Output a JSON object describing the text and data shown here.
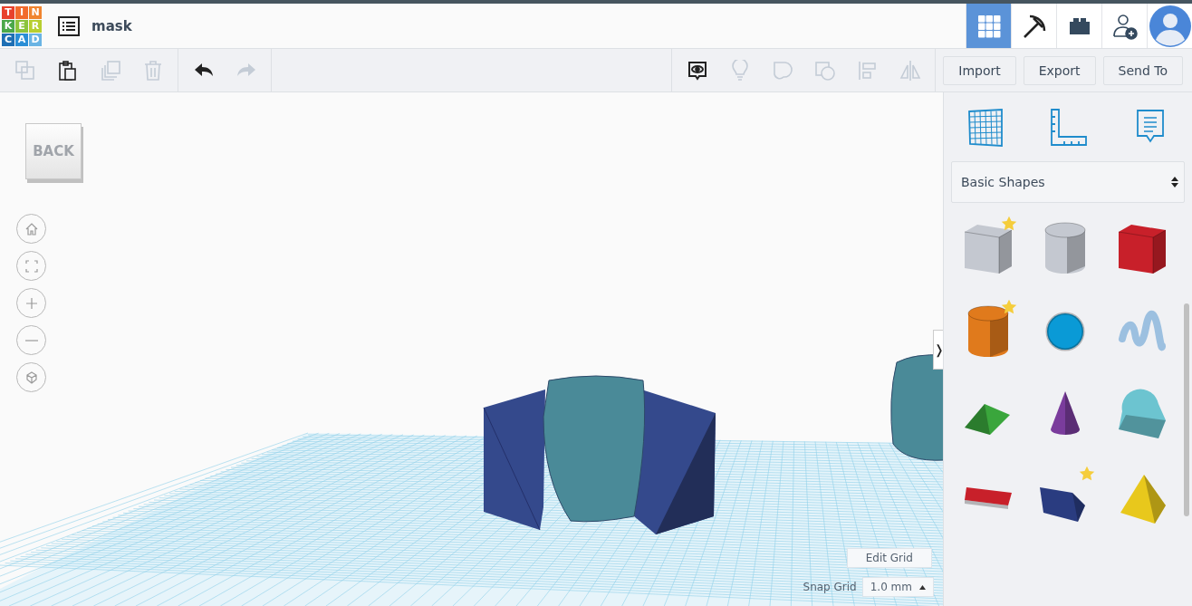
{
  "logo": {
    "letters": [
      "T",
      "I",
      "N",
      "K",
      "E",
      "R",
      "C",
      "A",
      "D"
    ]
  },
  "title": "mask",
  "nav": [
    {
      "kind": "grid",
      "selected": true
    },
    {
      "kind": "pickaxe",
      "selected": false
    },
    {
      "kind": "brick",
      "selected": false
    },
    {
      "kind": "invite",
      "selected": false
    },
    {
      "kind": "avatar",
      "selected": false
    }
  ],
  "edit_tools": [
    {
      "kind": "copy",
      "disabled": true
    },
    {
      "kind": "paste",
      "disabled": false
    },
    {
      "kind": "duplicate",
      "disabled": true
    },
    {
      "kind": "delete",
      "disabled": true
    }
  ],
  "history_tools": [
    {
      "kind": "undo",
      "disabled": false
    },
    {
      "kind": "redo",
      "disabled": true
    }
  ],
  "view_tools": [
    {
      "kind": "notes",
      "disabled": false
    },
    {
      "kind": "bulb",
      "disabled": true
    },
    {
      "kind": "group",
      "disabled": true
    },
    {
      "kind": "ungroup",
      "disabled": true
    },
    {
      "kind": "align",
      "disabled": true
    },
    {
      "kind": "mirror",
      "disabled": true
    }
  ],
  "actions": [
    "Import",
    "Export",
    "Send To"
  ],
  "view_cube": "BACK",
  "view_controls": [
    {
      "kind": "home"
    },
    {
      "kind": "fit"
    },
    {
      "kind": "zoom-in"
    },
    {
      "kind": "zoom-out"
    },
    {
      "kind": "perspective"
    }
  ],
  "edit_grid": "Edit Grid",
  "snap_grid": {
    "label": "Snap Grid",
    "value": "1.0 mm"
  },
  "panel_toggle": "❭",
  "panel_tools": [
    {
      "kind": "workplane"
    },
    {
      "kind": "ruler"
    },
    {
      "kind": "note"
    }
  ],
  "shape_library": "Basic Shapes",
  "shapes": [
    {
      "kind": "box",
      "color": "#c4c8d0",
      "favorite": true
    },
    {
      "kind": "cylinder",
      "color": "#c4c8d0",
      "favorite": false
    },
    {
      "kind": "box",
      "color": "#c8202a",
      "favorite": false
    },
    {
      "kind": "cylinder",
      "color": "#e07a1c",
      "favorite": true
    },
    {
      "kind": "sphere",
      "color": "#0a9ad6",
      "favorite": false
    },
    {
      "kind": "scribble",
      "color": "#9cc0e0",
      "favorite": false
    },
    {
      "kind": "roof",
      "color": "#3aa63c",
      "favorite": false
    },
    {
      "kind": "cone",
      "color": "#7a3c9c",
      "favorite": false
    },
    {
      "kind": "round-roof",
      "color": "#6cc4d0",
      "favorite": false
    },
    {
      "kind": "text",
      "color": "#c8202a",
      "favorite": false
    },
    {
      "kind": "wedge",
      "color": "#2a3c80",
      "favorite": true
    },
    {
      "kind": "pyramid",
      "color": "#e8c81c",
      "favorite": false
    }
  ]
}
